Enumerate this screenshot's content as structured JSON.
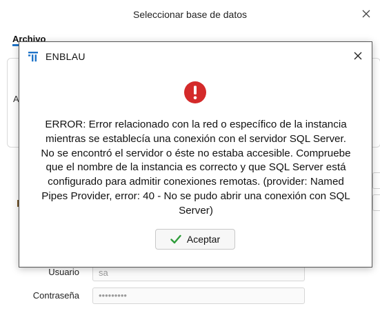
{
  "background_window": {
    "title": "Seleccionar base de datos",
    "tab_label": "Archivo",
    "panel_letter": "A",
    "fields": {
      "user_label": "Usuario",
      "user_value": "sa",
      "password_label": "Contraseña",
      "password_value": "•••••••••"
    }
  },
  "dialog": {
    "title": "ENBLAU",
    "message": "ERROR: Error relacionado con la red o específico de la instancia mientras se establecía una conexión con el servidor SQL Server. No se encontró el servidor o éste no estaba accesible. Compruebe que el nombre de la instancia es correcto y que SQL Server está configurado para admitir conexiones remotas. (provider: Named Pipes Provider, error: 40 - No se pudo abrir una conexión con SQL Server)",
    "ok_label": "Aceptar"
  },
  "colors": {
    "error_red": "#d42a2a",
    "check_green": "#2e9c3a",
    "accent_blue": "#1e73c8"
  },
  "icons": [
    "close-icon",
    "enblau-logo-icon",
    "error-icon",
    "check-icon"
  ]
}
